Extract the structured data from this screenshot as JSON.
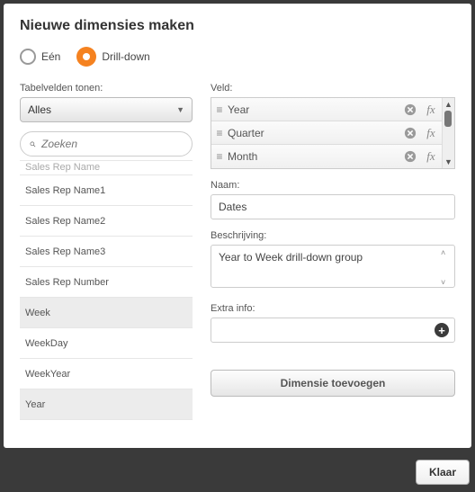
{
  "title": "Nieuwe dimensies maken",
  "radio": {
    "one": "Eén",
    "drill": "Drill-down"
  },
  "left": {
    "label": "Tabelvelden tonen:",
    "select_value": "Alles",
    "search_placeholder": "Zoeken",
    "items": [
      "Sales Rep Name",
      "Sales Rep Name1",
      "Sales Rep Name2",
      "Sales Rep Name3",
      "Sales Rep Number",
      "Week",
      "WeekDay",
      "WeekYear",
      "Year"
    ]
  },
  "veld": {
    "label": "Veld:",
    "rows": [
      "Year",
      "Quarter",
      "Month"
    ]
  },
  "naam": {
    "label": "Naam:",
    "value": "Dates"
  },
  "besch": {
    "label": "Beschrijving:",
    "value": "Year to Week drill-down group"
  },
  "extra": {
    "label": "Extra info:"
  },
  "add_btn": "Dimensie toevoegen",
  "footer_btn": "Klaar"
}
